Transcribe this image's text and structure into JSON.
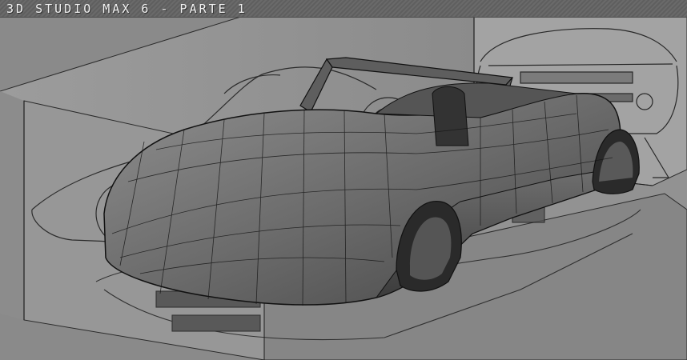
{
  "window": {
    "title": "3D Studio Max 6 - Parte 1"
  },
  "viewport": {
    "content": "car-model-wireframe",
    "colors": {
      "background": "#8a8a8a",
      "panel_light": "#9a9a9a",
      "panel_dark": "#7d7d7d",
      "edge": "#1f1f1f",
      "body_shade": "#5a5a5a",
      "body_highlight": "#8c8c8c"
    }
  }
}
